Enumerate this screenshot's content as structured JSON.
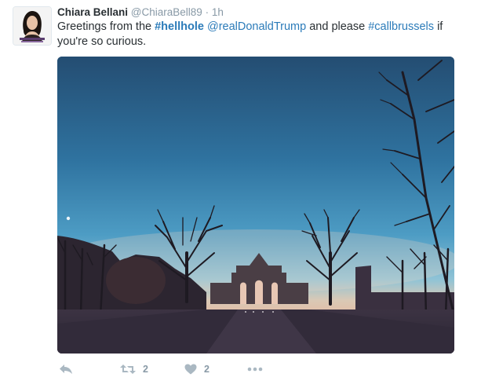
{
  "tweet": {
    "author_name": "Chiara Bellani",
    "author_handle": "@ChiaraBell89",
    "separator": "·",
    "time": "1h",
    "text_parts": {
      "t1": "Greetings from the ",
      "hashtag1": "#hellhole",
      "t2": " ",
      "mention": "@realDonaldTrump",
      "t3": " and please ",
      "hashtag2": "#callbrussels",
      "t4": " if you're so curious."
    }
  },
  "actions": {
    "reply_icon": "reply-arrow-icon",
    "retweet_icon": "retweet-icon",
    "retweet_count": "2",
    "like_icon": "heart-icon",
    "like_count": "2",
    "more_icon": "more-dots-icon"
  },
  "colors": {
    "link": "#2b7bb9",
    "muted": "#8899a6",
    "icon": "#aab8c2",
    "text": "#292f33"
  }
}
